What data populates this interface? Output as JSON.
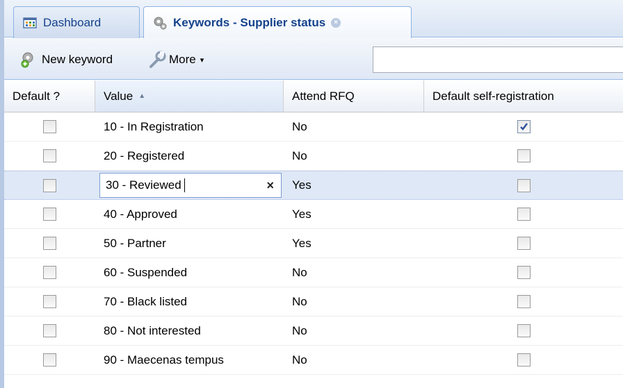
{
  "tabs": [
    {
      "label": "Dashboard",
      "icon": "dashboard-icon"
    },
    {
      "label": "Keywords - Supplier status",
      "icon": "gears-icon",
      "close": "×"
    }
  ],
  "toolbar": {
    "new_label": "New keyword",
    "more_label": "More",
    "more_caret": "▾",
    "search_value": ""
  },
  "grid": {
    "columns": [
      "Default ?",
      "Value",
      "Attend RFQ",
      "Default self-registration"
    ],
    "sort_indicator": "▲",
    "rows": [
      {
        "default": false,
        "value": "10 - In Registration",
        "attend_rfq": "No",
        "self_reg": true
      },
      {
        "default": false,
        "value": "20 - Registered",
        "attend_rfq": "No",
        "self_reg": false
      },
      {
        "default": false,
        "value": "30 - Reviewed",
        "attend_rfq": "Yes",
        "self_reg": false,
        "editing": true,
        "clear": "×"
      },
      {
        "default": false,
        "value": "40 - Approved",
        "attend_rfq": "Yes",
        "self_reg": false
      },
      {
        "default": false,
        "value": "50 - Partner",
        "attend_rfq": "Yes",
        "self_reg": false
      },
      {
        "default": false,
        "value": "60 - Suspended",
        "attend_rfq": "No",
        "self_reg": false
      },
      {
        "default": false,
        "value": "70 - Black listed",
        "attend_rfq": "No",
        "self_reg": false
      },
      {
        "default": false,
        "value": "80 - Not interested",
        "attend_rfq": "No",
        "self_reg": false
      },
      {
        "default": false,
        "value": "90 - Maecenas tempus",
        "attend_rfq": "No",
        "self_reg": false
      }
    ]
  },
  "colors": {
    "header_blue": "#15428b",
    "selected_row": "#dfe8f6",
    "border_blue": "#99bbe8"
  }
}
